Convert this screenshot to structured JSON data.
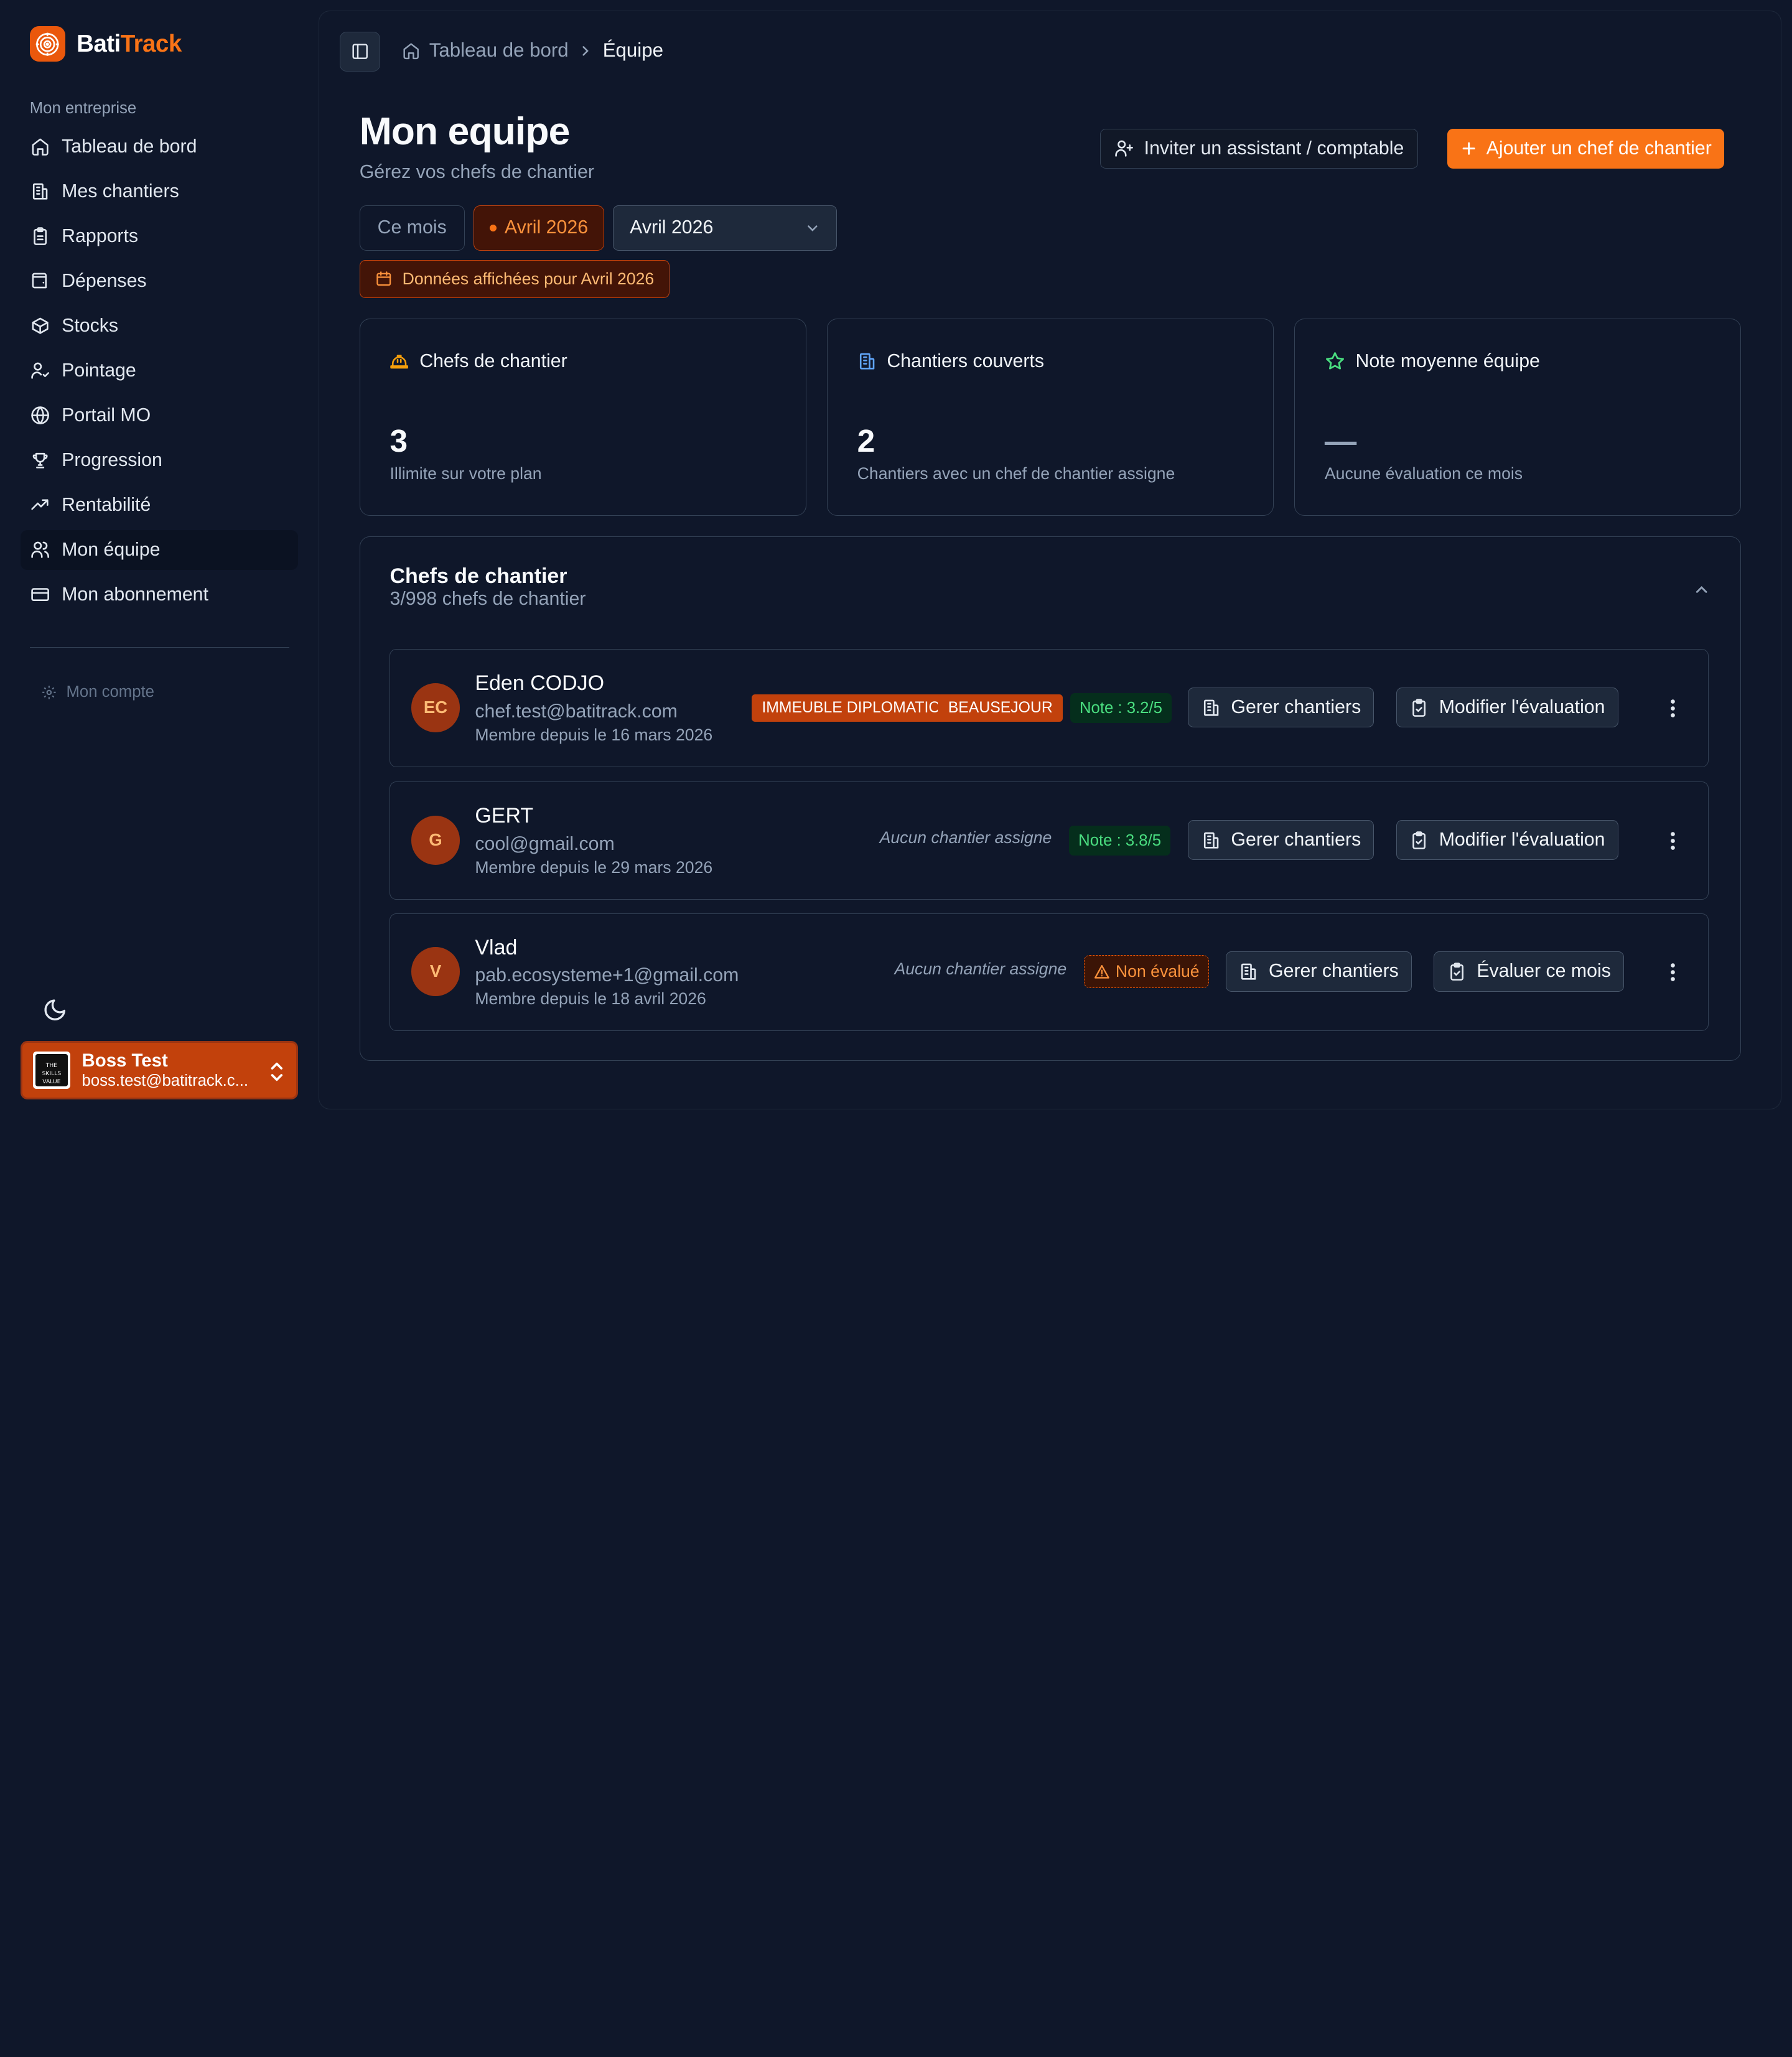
{
  "app": {
    "brand_part1": "Bati",
    "brand_part2": "Track",
    "accent": "#f97316"
  },
  "sidebar": {
    "heading": "Mon entreprise",
    "items": [
      {
        "label": "Tableau de bord",
        "icon": "home-icon"
      },
      {
        "label": "Mes chantiers",
        "icon": "building-icon"
      },
      {
        "label": "Rapports",
        "icon": "clipboard-icon"
      },
      {
        "label": "Dépenses",
        "icon": "wallet-icon"
      },
      {
        "label": "Stocks",
        "icon": "box-icon"
      },
      {
        "label": "Pointage",
        "icon": "user-check-icon"
      },
      {
        "label": "Portail MO",
        "icon": "globe-icon"
      },
      {
        "label": "Progression",
        "icon": "trophy-icon"
      },
      {
        "label": "Rentabilité",
        "icon": "trending-up-icon"
      },
      {
        "label": "Mon équipe",
        "icon": "users-icon",
        "active": true
      },
      {
        "label": "Mon abonnement",
        "icon": "credit-card-icon"
      }
    ],
    "account": "Mon compte",
    "user": {
      "name": "Boss Test",
      "email": "boss.test@batitrack.c...",
      "avatar_text": "THE SKILLS VALUE"
    }
  },
  "breadcrumb": {
    "home": "Tableau de bord",
    "current": "Équipe"
  },
  "page": {
    "title": "Mon equipe",
    "subtitle": "Gérez vos chefs de chantier",
    "invite_label": "Inviter un assistant / comptable",
    "add_label": "Ajouter un chef de chantier"
  },
  "filters": {
    "this_month": "Ce mois",
    "selected_month": "Avril 2026",
    "select_value": "Avril 2026",
    "notice": "Données affichées pour Avril 2026"
  },
  "stats": [
    {
      "label": "Chefs de chantier",
      "value": "3",
      "desc": "Illimite sur votre plan",
      "icon": "hard-hat-icon"
    },
    {
      "label": "Chantiers couverts",
      "value": "2",
      "desc": "Chantiers avec un chef de chantier assigne",
      "icon": "building-icon"
    },
    {
      "label": "Note moyenne équipe",
      "value": "—",
      "desc": "Aucune évaluation ce mois",
      "icon": "star-icon"
    }
  ],
  "team": {
    "title": "Chefs de chantier",
    "subtitle": "3/998 chefs de chantier",
    "manage_label": "Gerer chantiers",
    "members": [
      {
        "initials": "EC",
        "name": "Eden CODJO",
        "email": "chef.test@batitrack.com",
        "since": "Membre depuis le 16 mars 2026",
        "tags": [
          "IMMEUBLE DIPLOMATIC",
          "BEAUSEJOUR"
        ],
        "note": "Note : 3.2/5",
        "eval_label": "Modifier l'évaluation"
      },
      {
        "initials": "G",
        "name": "GERT",
        "email": "cool@gmail.com",
        "since": "Membre depuis le 29 mars 2026",
        "no_site": "Aucun chantier assigne",
        "note": "Note : 3.8/5",
        "eval_label": "Modifier l'évaluation"
      },
      {
        "initials": "V",
        "name": "Vlad",
        "email": "pab.ecosysteme+1@gmail.com",
        "since": "Membre depuis le 18 avril 2026",
        "no_site": "Aucun chantier assigne",
        "not_rated": "Non évalué",
        "eval_label": "Évaluer ce mois"
      }
    ]
  }
}
